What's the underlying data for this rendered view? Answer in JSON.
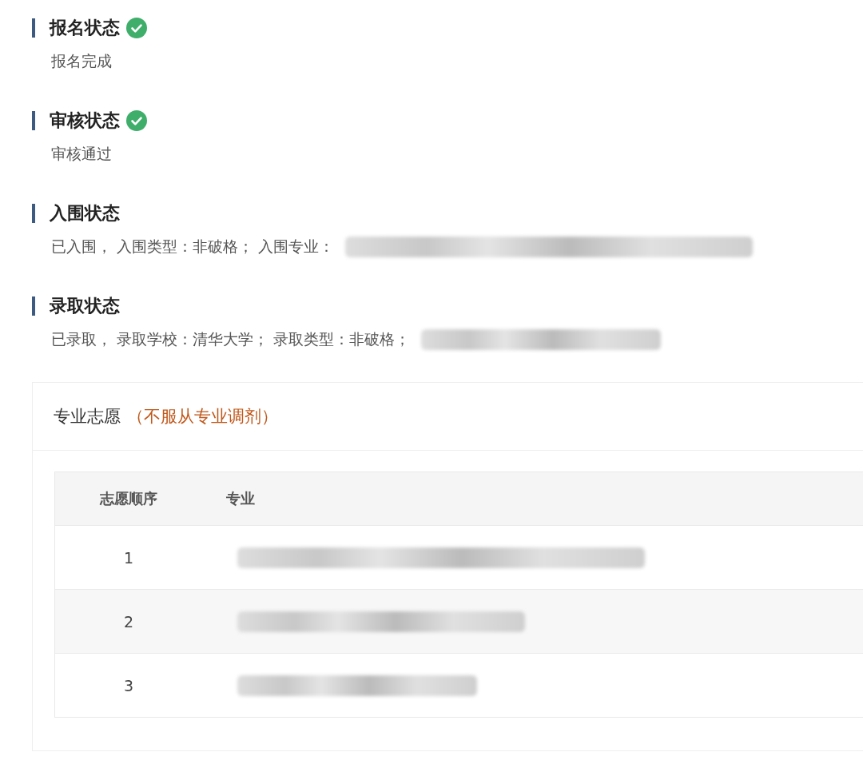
{
  "sections": [
    {
      "title": "报名状态",
      "verified": true,
      "detail": "报名完成",
      "redacted": false
    },
    {
      "title": "审核状态",
      "verified": true,
      "detail": "审核通过",
      "redacted": false
    },
    {
      "title": "入围状态",
      "verified": false,
      "detail": "已入围， 入围类型：非破格； 入围专业：",
      "redacted": true
    },
    {
      "title": "录取状态",
      "verified": false,
      "detail": "已录取， 录取学校：清华大学； 录取类型：非破格；",
      "redacted": true
    }
  ],
  "preferences": {
    "title": "专业志愿",
    "note": "（不服从专业调剂）",
    "columns": [
      "志愿顺序",
      "专业"
    ],
    "rows": [
      {
        "order": "1",
        "redacted": true
      },
      {
        "order": "2",
        "redacted": true
      },
      {
        "order": "3",
        "redacted": true
      }
    ]
  }
}
